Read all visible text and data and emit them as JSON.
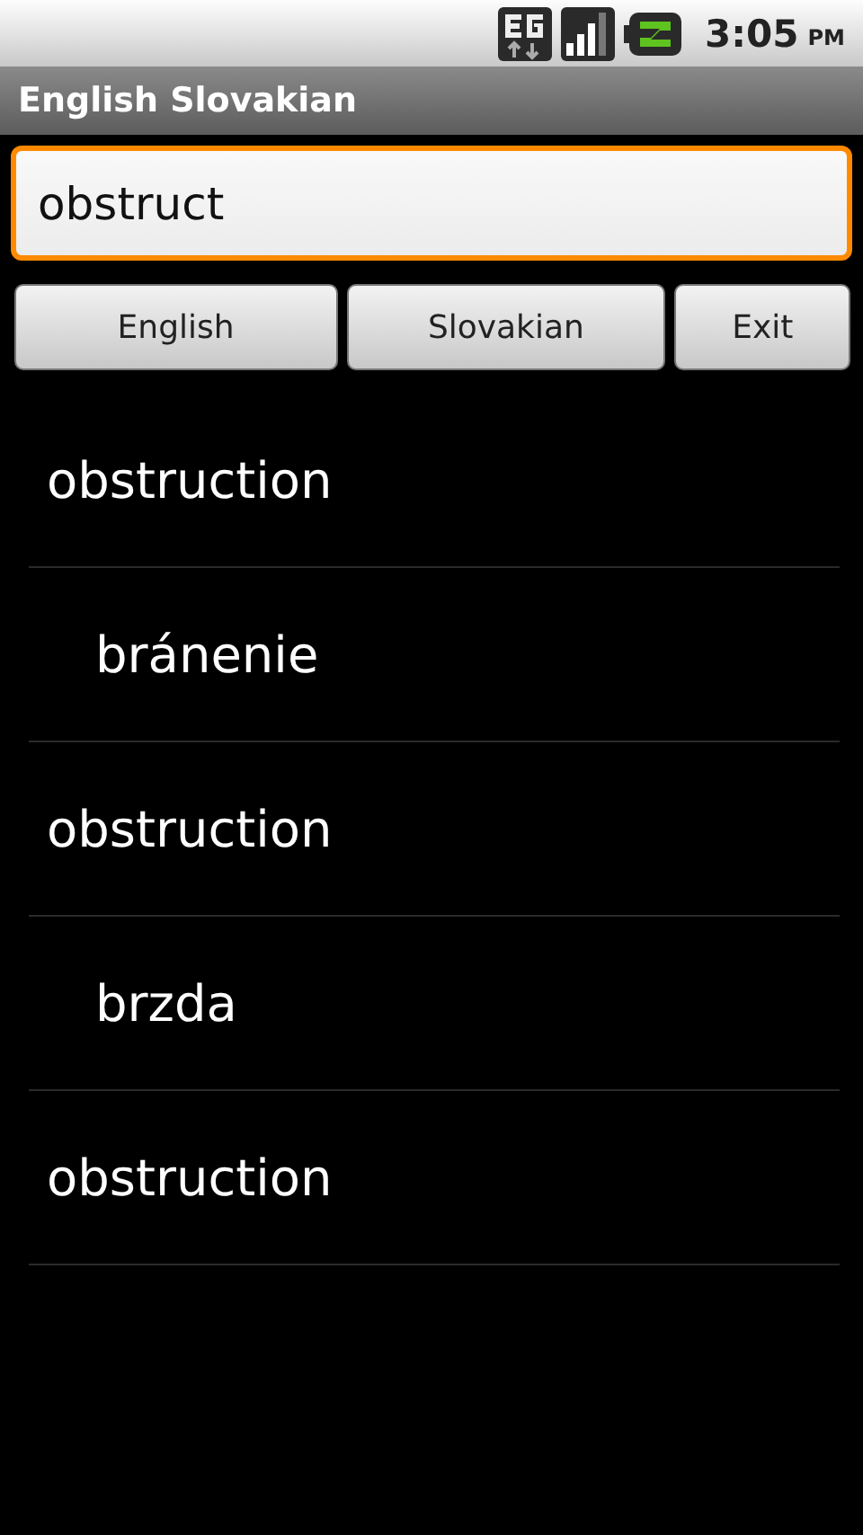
{
  "status_bar": {
    "time": "3:05",
    "meridiem": "PM"
  },
  "title": "English Slovakian",
  "search": {
    "value": "obstruct",
    "focused": true
  },
  "buttons": [
    "English",
    "Slovakian",
    "Exit"
  ],
  "results": [
    {
      "kind": "term",
      "text": "obstruction"
    },
    {
      "kind": "translation",
      "text": "bránenie"
    },
    {
      "kind": "term",
      "text": "obstruction"
    },
    {
      "kind": "translation",
      "text": "brzda"
    },
    {
      "kind": "term",
      "text": "obstruction"
    }
  ]
}
